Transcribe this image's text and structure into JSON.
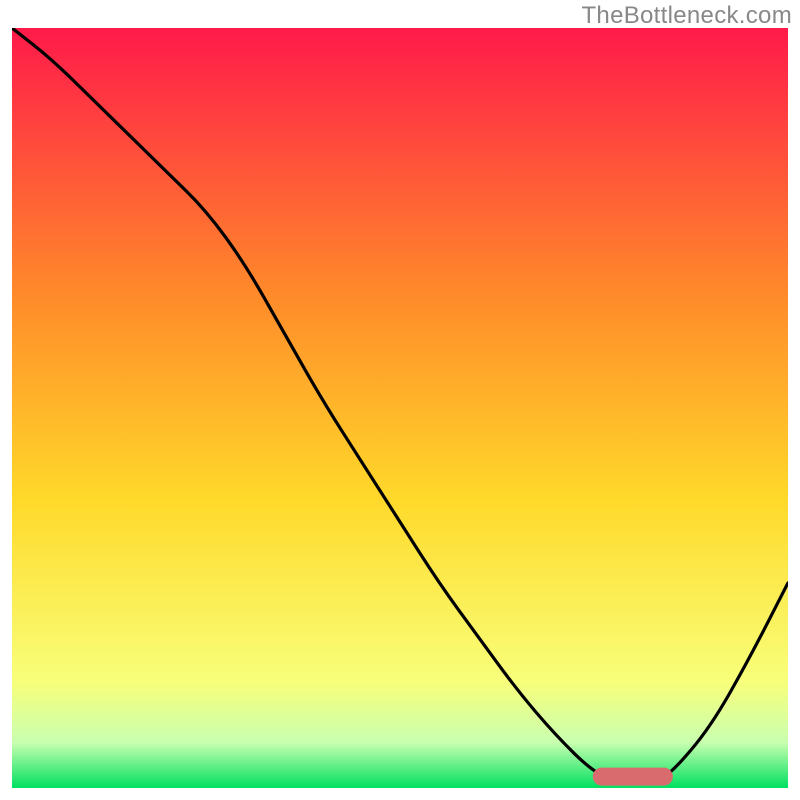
{
  "watermark": "TheBottleneck.com",
  "colors": {
    "gradient_top": "#ff1a4a",
    "gradient_upper_mid": "#ff8a2a",
    "gradient_mid": "#ffd92a",
    "gradient_lower": "#f8ff7a",
    "gradient_bottom_band": "#c9ffb0",
    "gradient_bottom": "#00e060",
    "curve": "#000000",
    "marker": "#d96b6e"
  },
  "chart_data": {
    "type": "line",
    "title": "",
    "xlabel": "",
    "ylabel": "",
    "xlim": [
      0,
      100
    ],
    "ylim": [
      0,
      100
    ],
    "x": [
      0,
      5,
      10,
      15,
      20,
      25,
      30,
      35,
      40,
      45,
      50,
      55,
      60,
      65,
      70,
      75,
      78,
      80,
      83,
      85,
      90,
      95,
      100
    ],
    "values": [
      100,
      96,
      91,
      86,
      81,
      76,
      69,
      60,
      51,
      43,
      35,
      27,
      20,
      13,
      7,
      2,
      1,
      1,
      1,
      2,
      8,
      17,
      27
    ],
    "marker": {
      "x_start": 76,
      "x_end": 84,
      "y": 1.5
    }
  }
}
